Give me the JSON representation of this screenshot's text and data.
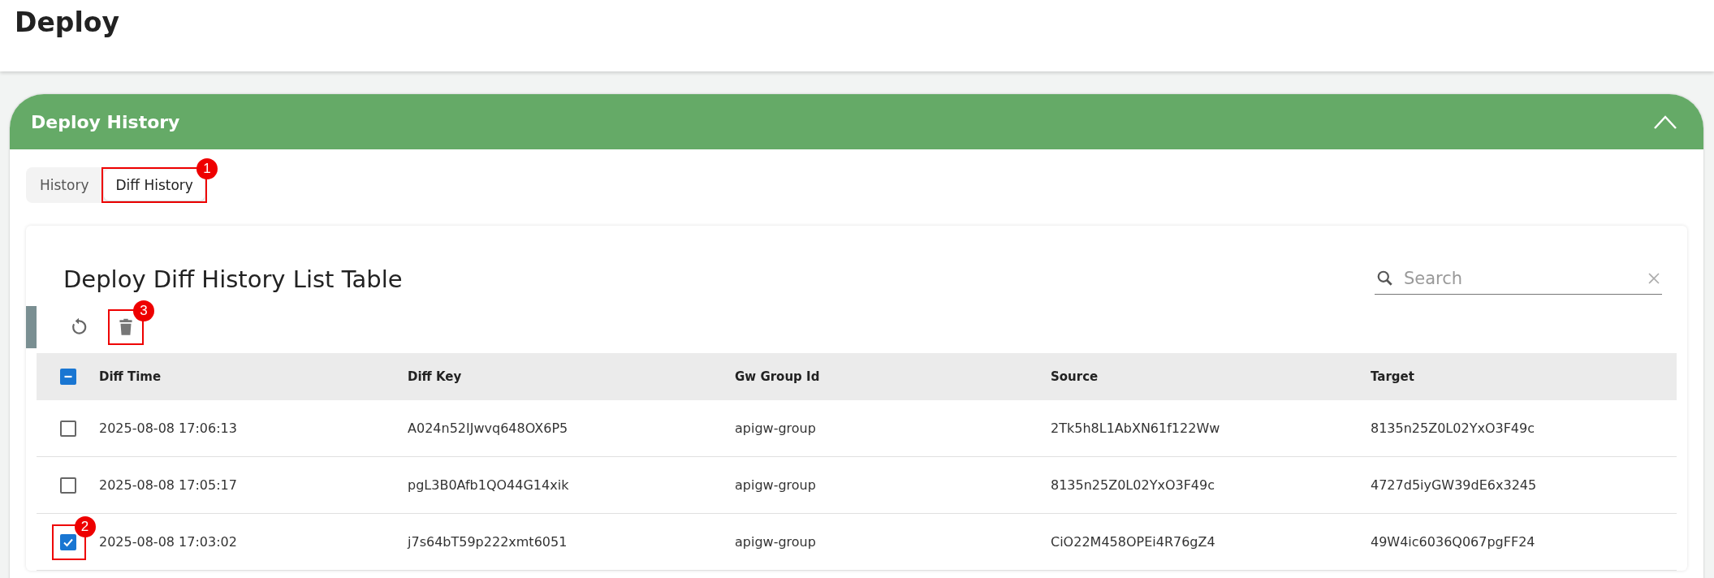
{
  "page": {
    "title": "Deploy"
  },
  "panel": {
    "title": "Deploy History",
    "expanded": true
  },
  "tabs": [
    {
      "label": "History",
      "selected": false
    },
    {
      "label": "Diff History",
      "selected": true,
      "annotation": "1"
    }
  ],
  "card": {
    "title": "Deploy Diff History List Table"
  },
  "search": {
    "placeholder": "Search"
  },
  "toolbar": [
    {
      "kind": "refresh"
    },
    {
      "kind": "delete",
      "annotation": "3"
    }
  ],
  "table": {
    "select_all_partial": true,
    "columns": [
      "Diff Time",
      "Diff Key",
      "Gw Group Id",
      "Source",
      "Target"
    ],
    "rows": [
      {
        "checked": false,
        "cells": [
          "2025-08-08 17:06:13",
          "A024n52IJwvq648OX6P5",
          "apigw-group",
          "2Tk5h8L1AbXN61f122Ww",
          "8135n25Z0L02YxO3F49c"
        ]
      },
      {
        "checked": false,
        "cells": [
          "2025-08-08 17:05:17",
          "pgL3B0Afb1QO44G14xik",
          "apigw-group",
          "8135n25Z0L02YxO3F49c",
          "4727d5iyGW39dE6x3245"
        ]
      },
      {
        "checked": true,
        "annotation": "2",
        "cells": [
          "2025-08-08 17:03:02",
          "j7s64bT59p222xmt6051",
          "apigw-group",
          "CiO22M458OPEi4R76gZ4",
          "49W4ic6036Q067pgFF24"
        ]
      }
    ]
  }
}
